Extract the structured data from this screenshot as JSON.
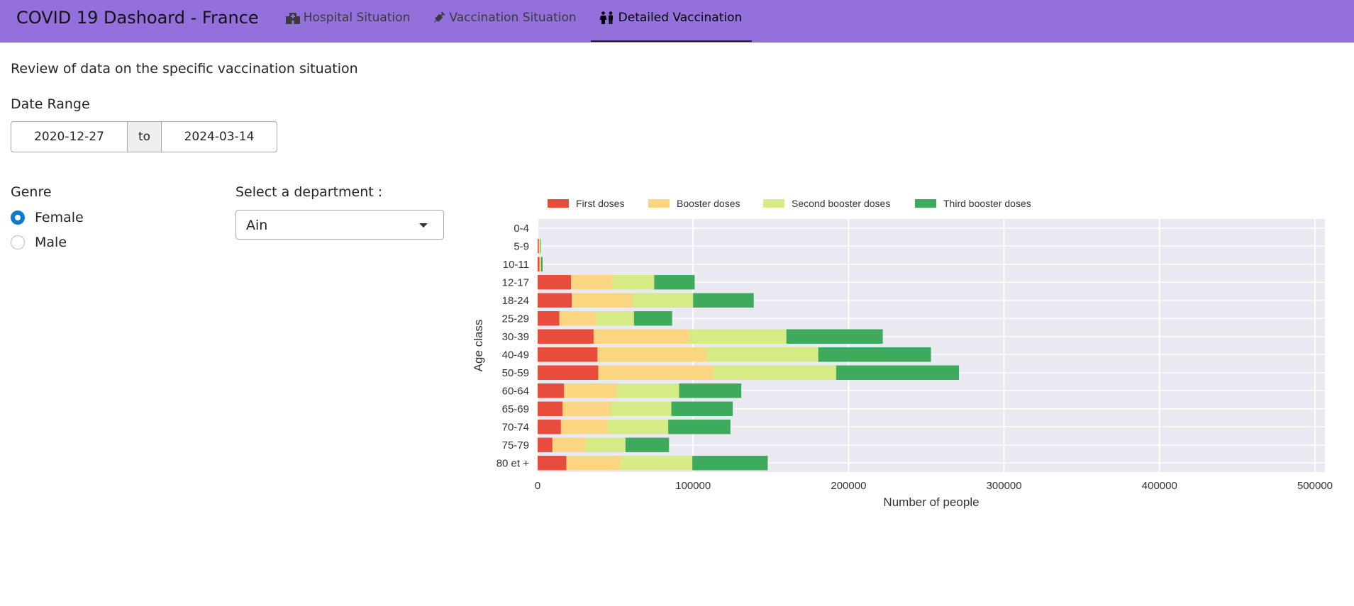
{
  "app": {
    "title": "COVID 19 Dashoard - France",
    "tabs": [
      {
        "label": "Hospital Situation",
        "icon": "hospital-icon"
      },
      {
        "label": "Vaccination Situation",
        "icon": "syringe-icon"
      },
      {
        "label": "Detailed Vaccination",
        "icon": "people-icon"
      }
    ],
    "active_tab": "Detailed Vaccination"
  },
  "page": {
    "subtitle": "Review of data on the specific vaccination situation"
  },
  "date_range": {
    "label": "Date Range",
    "start": "2020-12-27",
    "separator": "to",
    "end": "2024-03-14"
  },
  "genre": {
    "label": "Genre",
    "options": [
      "Female",
      "Male"
    ],
    "selected": "Female"
  },
  "department": {
    "label": "Select a department :",
    "selected": "Ain"
  },
  "colors": {
    "first_doses": "#e74c3c",
    "booster_doses": "#fcd581",
    "second_booster_doses": "#d6eb86",
    "third_booster_doses": "#3daa5c",
    "plot_bg": "#e9e9f1",
    "navbar": "#9370db"
  },
  "chart_data": {
    "type": "bar",
    "orientation": "horizontal",
    "stacked": true,
    "categories": [
      "0-4",
      "5-9",
      "10-11",
      "12-17",
      "18-24",
      "25-29",
      "30-39",
      "40-49",
      "50-59",
      "60-64",
      "65-69",
      "70-74",
      "75-79",
      "80 et +"
    ],
    "series": [
      {
        "name": "First doses",
        "values": [
          0,
          800,
          1200,
          21500,
          22000,
          14000,
          36000,
          38500,
          39000,
          17000,
          16000,
          15000,
          9500,
          18500
        ]
      },
      {
        "name": "Booster doses",
        "values": [
          0,
          600,
          700,
          26500,
          39000,
          24000,
          61500,
          70500,
          74000,
          34000,
          31000,
          30000,
          21000,
          35000
        ]
      },
      {
        "name": "Second booster doses",
        "values": [
          0,
          400,
          300,
          27000,
          39000,
          24000,
          62500,
          71500,
          79000,
          40000,
          39000,
          39000,
          26000,
          46000
        ]
      },
      {
        "name": "Third booster doses",
        "values": [
          0,
          200,
          1000,
          26000,
          39000,
          24500,
          62000,
          72500,
          79000,
          40000,
          39500,
          40000,
          28000,
          48500
        ]
      }
    ],
    "xlabel": "Number of people",
    "ylabel": "Age class",
    "xlim": [
      0,
      500000
    ],
    "xticks": [
      0,
      100000,
      200000,
      300000,
      400000,
      500000
    ],
    "grid": true,
    "legend": "top-left"
  }
}
